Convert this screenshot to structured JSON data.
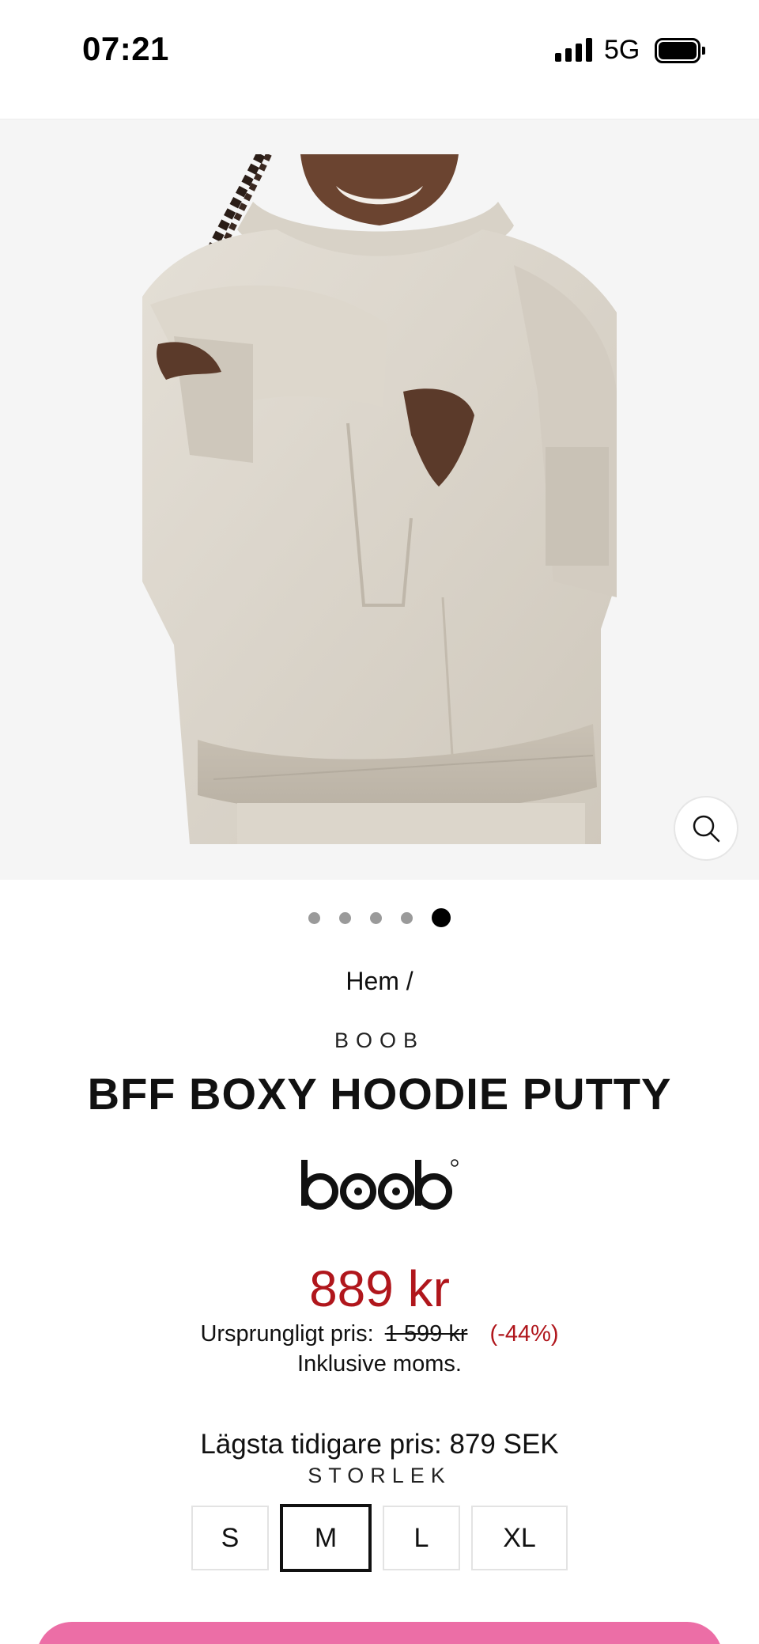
{
  "status_bar": {
    "time": "07:21",
    "network": "5G",
    "icons": [
      "signal-icon",
      "battery-icon"
    ]
  },
  "gallery": {
    "image_alt": "Woman wearing putty hoodie, lifting front nursing panel",
    "slide_count": 5,
    "active_slide": 5,
    "zoom_icon": "search-icon"
  },
  "product": {
    "breadcrumb": "Hem /",
    "brand": "BOOB",
    "title": "BFF BOXY HOODIE PUTTY",
    "logo_text": "boob",
    "price": "889 kr",
    "original_label": "Ursprungligt pris:",
    "original_price": "1 599 kr",
    "discount": "(-44%)",
    "vat_note": "Inklusive moms.",
    "lowest_price": "Lägsta tidigare pris: 879 SEK",
    "size_heading": "STORLEK",
    "sizes": [
      "S",
      "M",
      "L",
      "XL"
    ],
    "selected_size": "M"
  },
  "colors": {
    "price_red": "#b0161c",
    "cta_pink": "#ec6ea6",
    "hoodie": "#d9d3c8"
  }
}
